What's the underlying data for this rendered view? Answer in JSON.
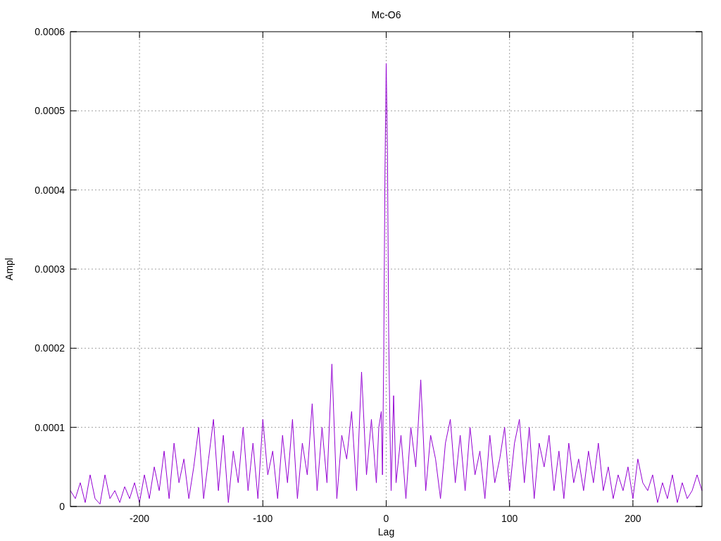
{
  "chart_data": {
    "type": "line",
    "title": "Mc-O6",
    "xlabel": "Lag",
    "ylabel": "Ampl",
    "xlim": [
      -256,
      256
    ],
    "grid": true,
    "ylim": [
      0,
      0.0006
    ],
    "xticks": [
      -200,
      -100,
      0,
      100,
      200
    ],
    "yticks": [
      {
        "value": 0,
        "label": "0"
      },
      {
        "value": 0.0001,
        "label": "0.0001"
      },
      {
        "value": 0.0002,
        "label": "0.0002"
      },
      {
        "value": 0.0003,
        "label": "0.0003"
      },
      {
        "value": 0.0004,
        "label": "0.0004"
      },
      {
        "value": 0.0005,
        "label": "0.0005"
      },
      {
        "value": 0.0006,
        "label": "0.0006"
      }
    ],
    "x": [
      -256,
      -252,
      -248,
      -244,
      -240,
      -236,
      -232,
      -228,
      -224,
      -220,
      -216,
      -212,
      -208,
      -204,
      -200,
      -196,
      -192,
      -188,
      -184,
      -180,
      -176,
      -172,
      -168,
      -164,
      -160,
      -156,
      -152,
      -148,
      -144,
      -140,
      -136,
      -132,
      -128,
      -124,
      -120,
      -116,
      -112,
      -108,
      -104,
      -100,
      -96,
      -92,
      -88,
      -84,
      -80,
      -76,
      -72,
      -68,
      -64,
      -60,
      -56,
      -52,
      -48,
      -44,
      -40,
      -36,
      -32,
      -28,
      -24,
      -20,
      -16,
      -12,
      -8,
      -6,
      -4,
      -3,
      -2,
      -1,
      0,
      1,
      2,
      3,
      4,
      6,
      8,
      12,
      16,
      20,
      24,
      28,
      32,
      36,
      40,
      44,
      48,
      52,
      56,
      60,
      64,
      68,
      72,
      76,
      80,
      84,
      88,
      92,
      96,
      100,
      104,
      108,
      112,
      116,
      120,
      124,
      128,
      132,
      136,
      140,
      144,
      148,
      152,
      156,
      160,
      164,
      168,
      172,
      176,
      180,
      184,
      188,
      192,
      196,
      200,
      204,
      208,
      212,
      216,
      220,
      224,
      228,
      232,
      236,
      240,
      244,
      248,
      252,
      256
    ],
    "series": [
      {
        "color": "#9400d3",
        "values": [
          2e-05,
          1e-05,
          3e-05,
          5e-06,
          4e-05,
          1e-05,
          3e-06,
          4e-05,
          1e-05,
          2e-05,
          5e-06,
          2.5e-05,
          1e-05,
          3e-05,
          5e-06,
          4e-05,
          1e-05,
          5e-05,
          2e-05,
          7e-05,
          1e-05,
          8e-05,
          3e-05,
          6e-05,
          1e-05,
          5e-05,
          0.0001,
          1e-05,
          6e-05,
          0.00011,
          2e-05,
          9e-05,
          5e-06,
          7e-05,
          3e-05,
          0.0001,
          2e-05,
          8e-05,
          1e-05,
          0.00011,
          4e-05,
          7e-05,
          1e-05,
          9e-05,
          3e-05,
          0.00011,
          1e-05,
          8e-05,
          4e-05,
          0.00013,
          2e-05,
          0.0001,
          3e-05,
          0.00018,
          1e-05,
          9e-05,
          6e-05,
          0.00012,
          2e-05,
          0.00017,
          4e-05,
          0.00011,
          3e-05,
          0.0001,
          0.00012,
          4e-05,
          0.00019,
          0.00042,
          0.00056,
          0.00045,
          0.00022,
          0.0001,
          2e-05,
          0.00014,
          3e-05,
          9e-05,
          1e-05,
          0.0001,
          5e-05,
          0.00016,
          2e-05,
          9e-05,
          6e-05,
          1e-05,
          8e-05,
          0.00011,
          3e-05,
          9e-05,
          2e-05,
          0.0001,
          4e-05,
          7e-05,
          1e-05,
          9e-05,
          3e-05,
          6e-05,
          0.0001,
          2e-05,
          8e-05,
          0.00011,
          3e-05,
          0.0001,
          1e-05,
          8e-05,
          5e-05,
          9e-05,
          2e-05,
          7e-05,
          1e-05,
          8e-05,
          3e-05,
          6e-05,
          2e-05,
          7e-05,
          3e-05,
          8e-05,
          2e-05,
          5e-05,
          1e-05,
          4e-05,
          2e-05,
          5e-05,
          1e-05,
          6e-05,
          3e-05,
          2e-05,
          4e-05,
          5e-06,
          3e-05,
          1e-05,
          4e-05,
          5e-06,
          3e-05,
          1e-05,
          2e-05,
          4e-05,
          2e-05
        ]
      }
    ]
  }
}
